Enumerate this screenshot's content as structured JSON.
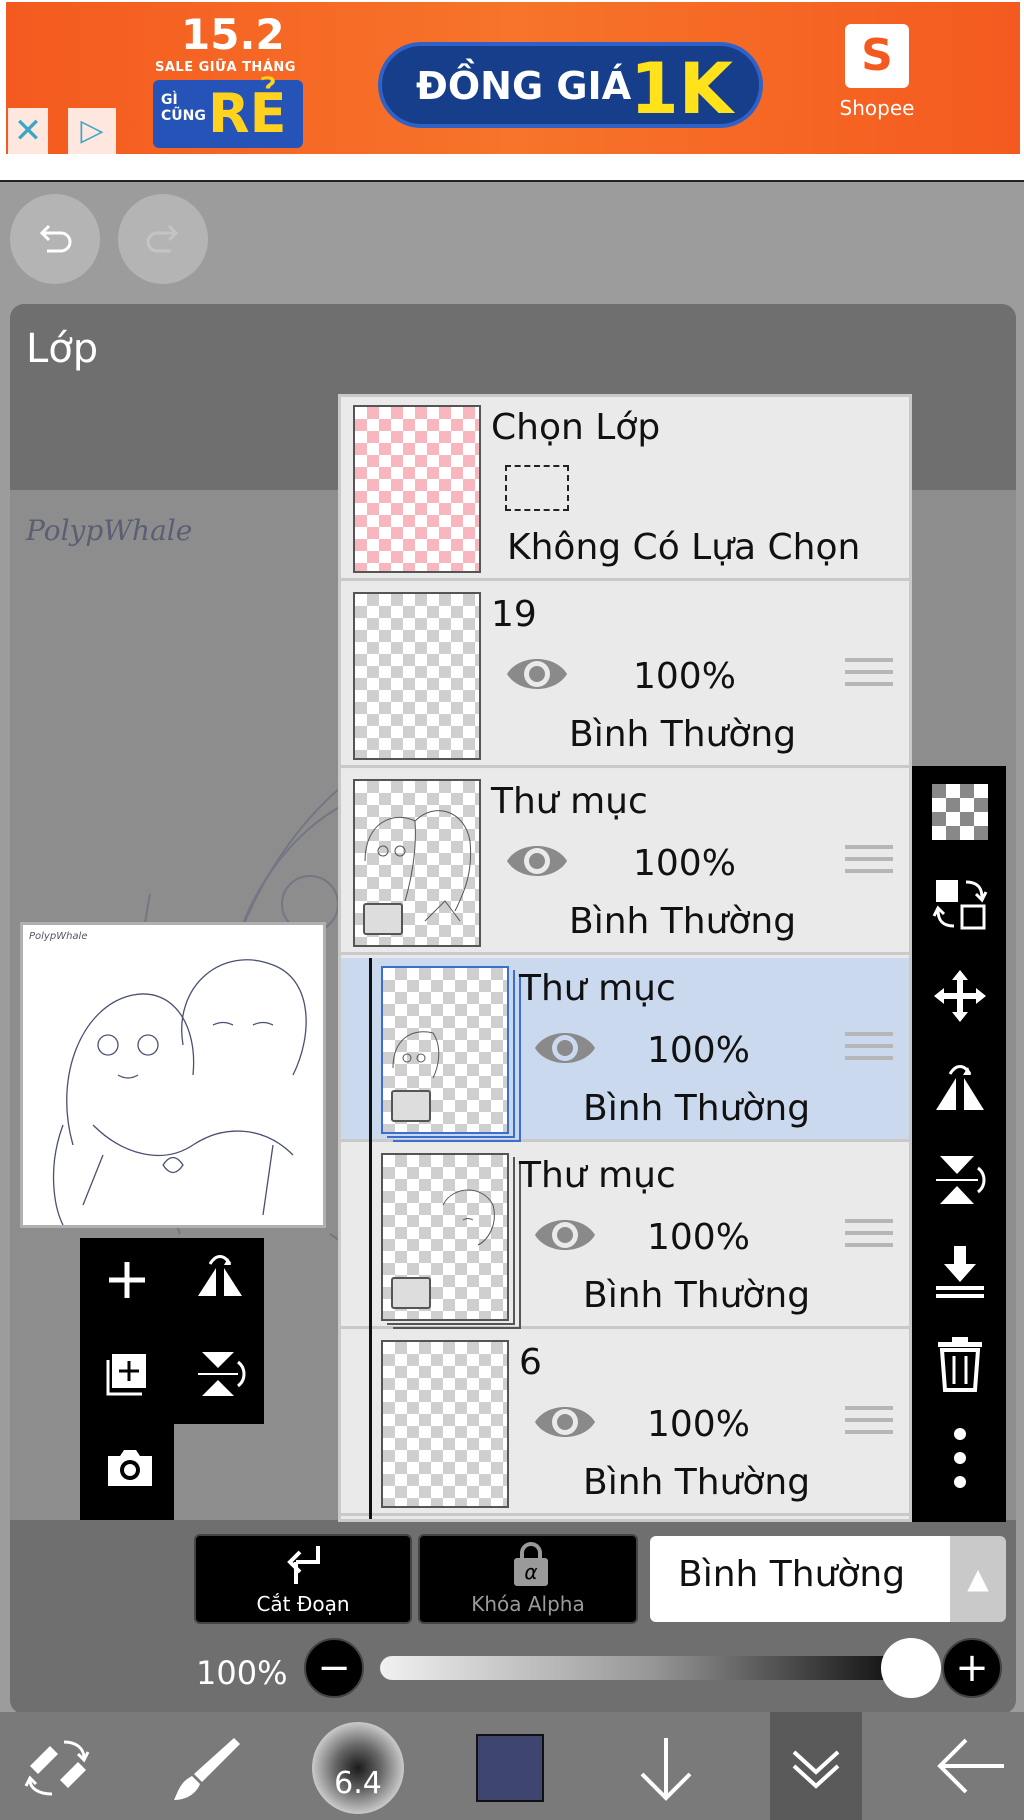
{
  "ad": {
    "sale_number": "15.2",
    "sale_subtitle": "SALE GIỮA THÁNG",
    "gi_cung_text": "GÌ CŨNG",
    "re_text": "RẺ",
    "pill_text": "ĐỒNG GIÁ",
    "pill_price": "1K",
    "shop_letter": "S",
    "shop_label": "Shopee",
    "close_glyph": "✕",
    "info_glyph": "▷"
  },
  "panel": {
    "title": "Lớp",
    "watermark": "PolypWhale",
    "thumbnail_watermark": "PolypWhale"
  },
  "selection_layer": {
    "name": "Chọn Lớp",
    "status": "Không Có Lựa Chọn"
  },
  "layers": [
    {
      "name": "19",
      "opacity": "100%",
      "blend": "Bình Thường",
      "type": "layer",
      "indent": 0
    },
    {
      "name": "Thư mục",
      "opacity": "100%",
      "blend": "Bình Thường",
      "type": "folder",
      "indent": 0
    },
    {
      "name": "Thư mục",
      "opacity": "100%",
      "blend": "Bình Thường",
      "type": "folder",
      "indent": 1,
      "selected": true
    },
    {
      "name": "Thư mục",
      "opacity": "100%",
      "blend": "Bình Thường",
      "type": "folder",
      "indent": 1
    },
    {
      "name": "6",
      "opacity": "100%",
      "blend": "Bình Thường",
      "type": "layer",
      "indent": 1
    }
  ],
  "controls": {
    "clip_label": "Cắt Đoạn",
    "alpha_label": "Khóa Alpha",
    "alpha_glyph": "α",
    "blend_mode": "Bình Thường",
    "blend_arrow": "▲",
    "opacity_label": "100%",
    "opacity_value": 1.0,
    "minus_glyph": "−",
    "plus_glyph": "+"
  },
  "bottom_bar": {
    "brush_size": "6.4",
    "current_color": "#3e4570"
  },
  "left_tools": {
    "add_glyph": "+",
    "add_copy_glyph": "+"
  }
}
